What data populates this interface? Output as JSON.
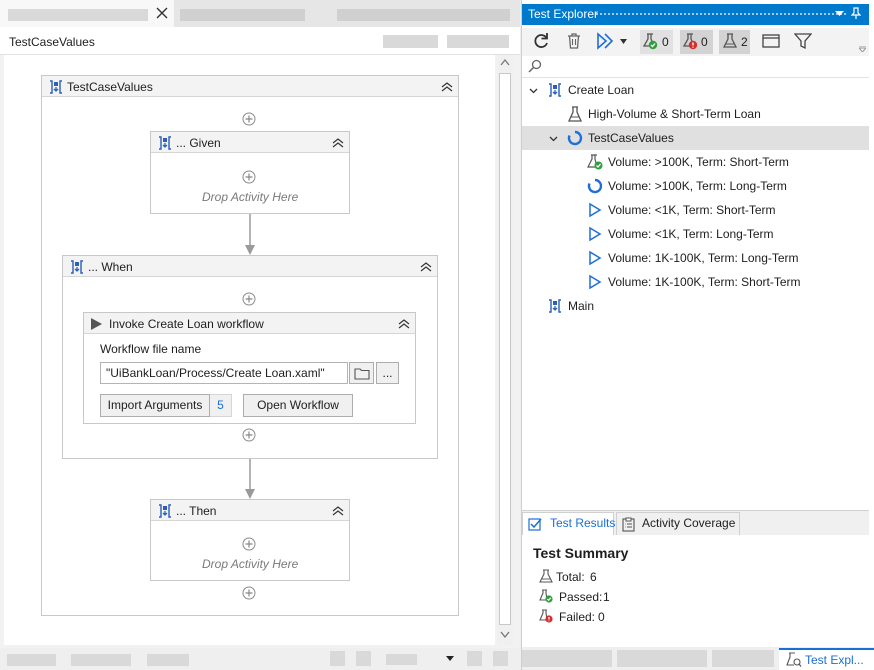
{
  "designer": {
    "doc_title": "TestCaseValues",
    "outer_title": "TestCaseValues",
    "given": {
      "title": "... Given",
      "drop": "Drop Activity Here"
    },
    "when": {
      "title": "... When"
    },
    "invoke": {
      "title": "Invoke Create Loan workflow",
      "field_label": "Workflow file name",
      "file_value": "\"UiBankLoan/Process/Create Loan.xaml\"",
      "more_label": "...",
      "import_label": "Import Arguments",
      "import_count": "5",
      "open_label": "Open Workflow"
    },
    "then": {
      "title": "... Then",
      "drop": "Drop Activity Here"
    }
  },
  "explorer": {
    "title": "Test Explorer",
    "toolbar": {
      "passed_count": "0",
      "failed_count": "0",
      "total_count": "2"
    },
    "tree": [
      {
        "label": "Create Loan",
        "icon": "workflow-icon",
        "expanded": true,
        "depth": 0
      },
      {
        "label": "High-Volume & Short-Term Loan",
        "icon": "flask-icon",
        "depth": 1
      },
      {
        "label": "TestCaseValues",
        "icon": "spinner-icon",
        "expanded": true,
        "selected": true,
        "depth": 1
      },
      {
        "label": "Volume: >100K, Term: Short-Term",
        "icon": "flask-passed-icon",
        "depth": 2
      },
      {
        "label": "Volume: >100K, Term: Long-Term",
        "icon": "spinner-icon",
        "depth": 2
      },
      {
        "label": "Volume: <1K, Term: Short-Term",
        "icon": "play-outline-icon",
        "depth": 2
      },
      {
        "label": "Volume: <1K, Term: Long-Term",
        "icon": "play-outline-icon",
        "depth": 2
      },
      {
        "label": "Volume: 1K-100K, Term: Long-Term",
        "icon": "play-outline-icon",
        "depth": 2
      },
      {
        "label": "Volume: 1K-100K, Term: Short-Term",
        "icon": "play-outline-icon",
        "depth": 2
      },
      {
        "label": "Main",
        "icon": "workflow-icon",
        "depth": 0
      }
    ],
    "tabs": {
      "results": "Test Results",
      "coverage": "Activity Coverage"
    },
    "summary": {
      "heading": "Test Summary",
      "total_label": "Total:",
      "total": "6",
      "passed_label": "Passed:",
      "passed": "1",
      "failed_label": "Failed:",
      "failed": "0"
    },
    "status_tab": "Test Expl..."
  },
  "colors": {
    "accent": "#007acc",
    "spinner": "#1e6fd9",
    "passed": "#2e9e3e",
    "failed": "#d32f2f"
  }
}
